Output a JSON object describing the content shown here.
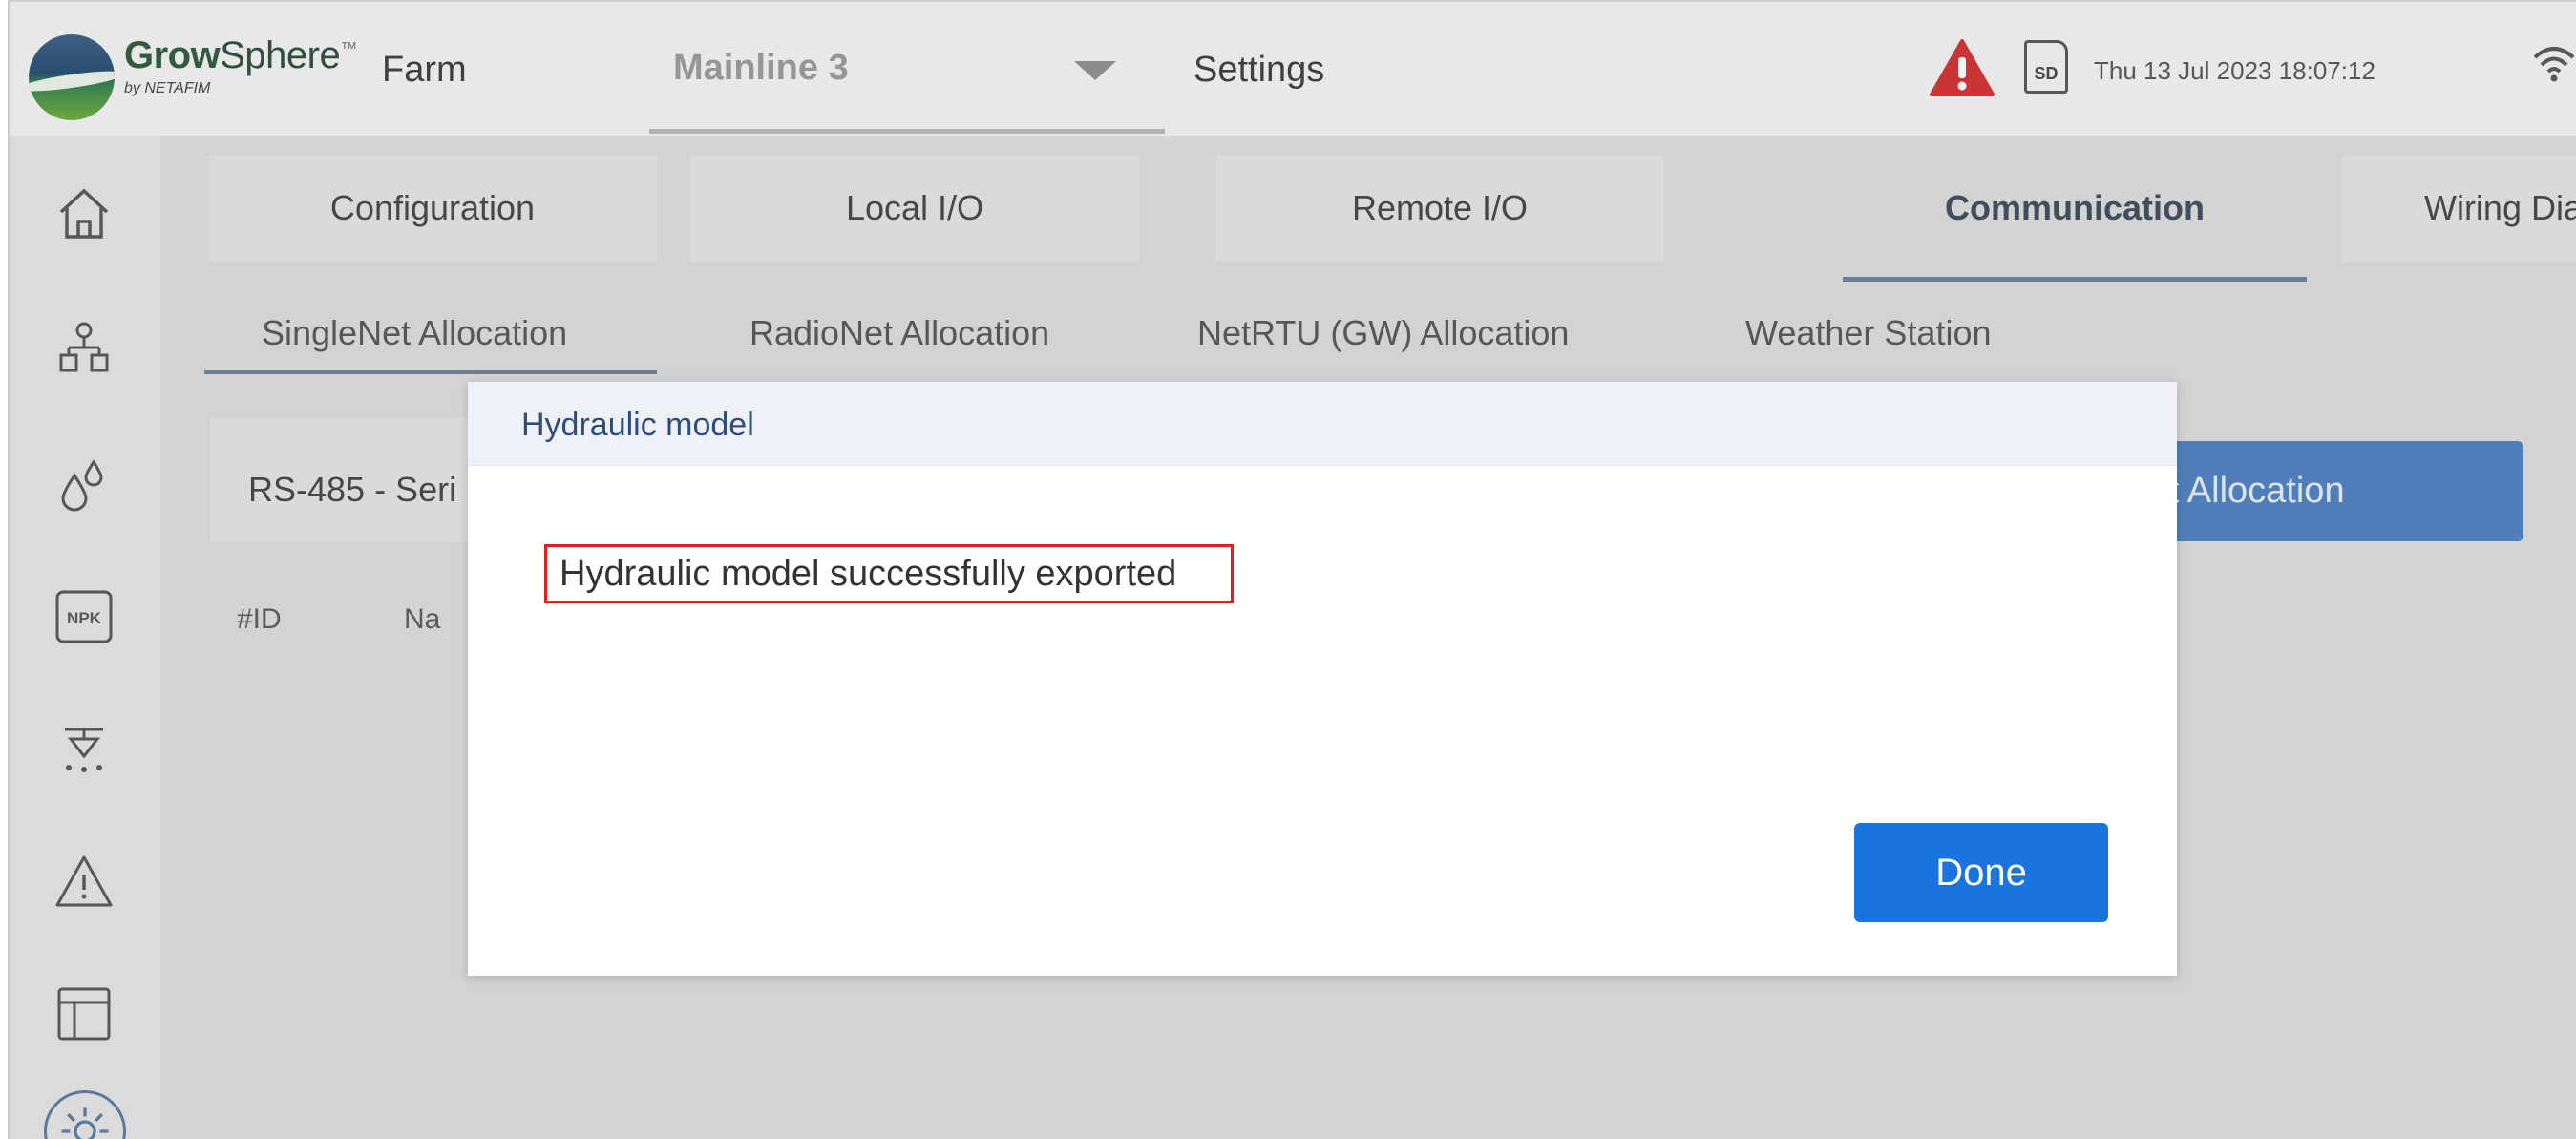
{
  "header": {
    "logo_brand_bold": "Grow",
    "logo_brand_rest": "Sphere",
    "logo_tm": "™",
    "logo_sub": "by NETAFIM",
    "farm_label": "Farm",
    "mainline_label": "Mainline 3",
    "settings_label": "Settings",
    "sd_label": "SD",
    "datetime": "Thu 13 Jul 2023   18:07:12"
  },
  "sidebar": {
    "items": [
      {
        "icon": "home-icon"
      },
      {
        "icon": "network-icon"
      },
      {
        "icon": "water-drops-icon"
      },
      {
        "icon": "npk-icon",
        "label": "NPK"
      },
      {
        "icon": "sprinkler-icon"
      },
      {
        "icon": "alert-icon"
      },
      {
        "icon": "table-layout-icon"
      },
      {
        "icon": "settings-icon"
      }
    ]
  },
  "tabs": [
    {
      "label": "Configuration",
      "active": false
    },
    {
      "label": "Local I/O",
      "active": false
    },
    {
      "label": "Remote  I/O",
      "active": false
    },
    {
      "label": "Communication",
      "active": true
    },
    {
      "label": "Wiring Diagram",
      "active": false
    }
  ],
  "subtabs": [
    {
      "label": "SingleNet Allocation",
      "active": true
    },
    {
      "label": "RadioNet Allocation",
      "active": false
    },
    {
      "label": "NetRTU (GW) Allocation",
      "active": false
    },
    {
      "label": "Weather Station",
      "active": false
    }
  ],
  "panel": {
    "rs485_label": "RS-485 - Seri",
    "start_allocation_label": "art Allocation",
    "col_id": "#ID",
    "col_name": "Na"
  },
  "modal": {
    "title": "Hydraulic model",
    "message": "Hydraulic model successfully exported",
    "done_label": "Done"
  },
  "colors": {
    "accent_blue": "#1a74e0",
    "warning_red": "#d32f2f",
    "highlight_border": "#e02020"
  }
}
